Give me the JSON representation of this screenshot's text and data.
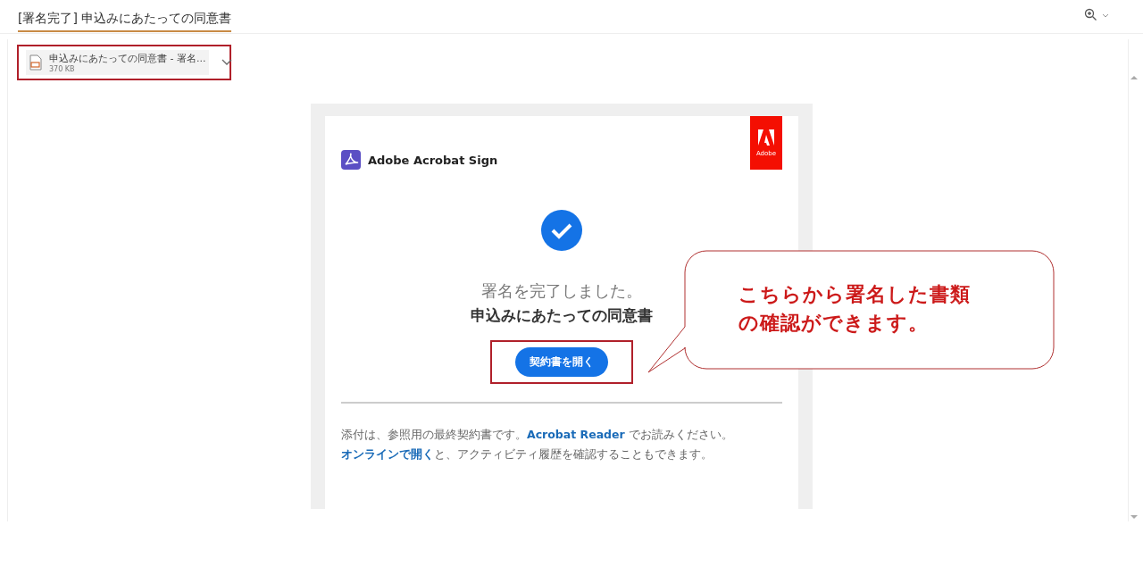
{
  "subject": "[署名完了] 申込みにあたっての同意書",
  "attachment": {
    "name": "申込みにあたっての同意書 - 署名...",
    "size": "370 KB",
    "highlighted": true
  },
  "email": {
    "brand": "Adobe Acrobat Sign",
    "adobe_logo": "Adobe",
    "status": "署名を完了しました。",
    "document": "申込みにあたっての同意書",
    "button": "契約書を開く",
    "button_highlighted": true,
    "footer": [
      {
        "kind": "text",
        "text": "添付は、参照用の最終契約書です。"
      },
      {
        "kind": "link",
        "text": "Acrobat Reader"
      },
      {
        "kind": "text",
        "text": " でお読みください。"
      },
      {
        "kind": "link",
        "text": "オンラインで開く"
      },
      {
        "kind": "text",
        "text": "と、アクティビティ履歴を確認することもできます。"
      }
    ]
  },
  "callout": {
    "lines": [
      "こちらから署名した書類",
      "の確認ができます。"
    ]
  }
}
